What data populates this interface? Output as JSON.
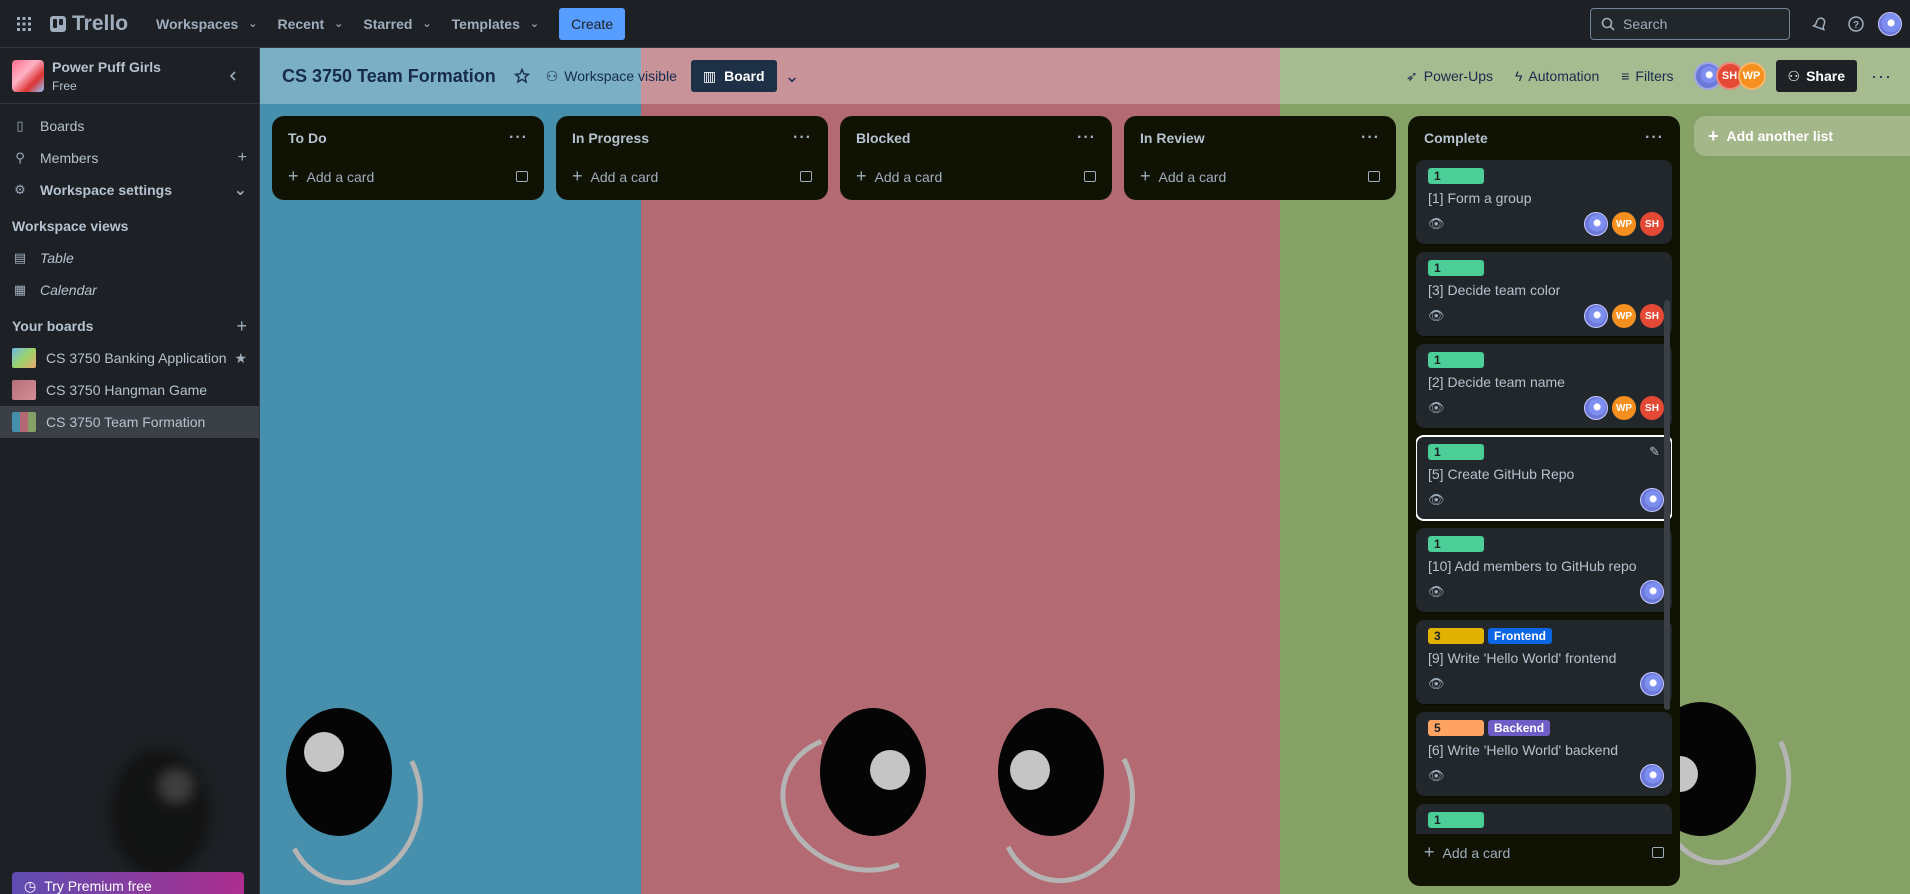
{
  "topnav": {
    "logo": "Trello",
    "menus": [
      "Workspaces",
      "Recent",
      "Starred",
      "Templates"
    ],
    "create": "Create",
    "search_placeholder": "Search"
  },
  "sidebar": {
    "workspace_name": "Power Puff Girls",
    "workspace_plan": "Free",
    "items": [
      {
        "label": "Boards"
      },
      {
        "label": "Members"
      },
      {
        "label": "Workspace settings"
      }
    ],
    "views_heading": "Workspace views",
    "views": [
      {
        "label": "Table"
      },
      {
        "label": "Calendar"
      }
    ],
    "your_boards_heading": "Your boards",
    "boards": [
      {
        "label": "CS 3750 Banking Application"
      },
      {
        "label": "CS 3750 Hangman Game"
      },
      {
        "label": "CS 3750 Team Formation"
      }
    ],
    "premium": "Try Premium free"
  },
  "board_header": {
    "title": "CS 3750 Team Formation",
    "visibility": "Workspace visible",
    "view": "Board",
    "powerups": "Power-Ups",
    "automation": "Automation",
    "filters": "Filters",
    "members": [
      "SH",
      "WP"
    ],
    "share": "Share"
  },
  "lists": [
    {
      "title": "To Do",
      "add": "Add a card"
    },
    {
      "title": "In Progress",
      "add": "Add a card"
    },
    {
      "title": "Blocked",
      "add": "Add a card"
    },
    {
      "title": "In Review",
      "add": "Add a card"
    },
    {
      "title": "Complete",
      "add": "Add a card"
    }
  ],
  "complete_cards": [
    {
      "labels": [
        "1"
      ],
      "title": "[1] Form a group",
      "members": [
        "me",
        "WP",
        "SH"
      ]
    },
    {
      "labels": [
        "1"
      ],
      "title": "[3] Decide team color",
      "members": [
        "me",
        "WP",
        "SH"
      ]
    },
    {
      "labels": [
        "1"
      ],
      "title": "[2] Decide team name",
      "members": [
        "me",
        "WP",
        "SH"
      ]
    },
    {
      "labels": [
        "1"
      ],
      "title": "[5] Create GitHub Repo",
      "members": [
        "me"
      ]
    },
    {
      "labels": [
        "1"
      ],
      "title": "[10] Add members to GitHub repo",
      "members": [
        "me"
      ]
    },
    {
      "labels": [
        "3",
        "Frontend"
      ],
      "title": "[9] Write 'Hello World' frontend",
      "members": [
        "me"
      ]
    },
    {
      "labels": [
        "5",
        "Backend"
      ],
      "title": "[6] Write 'Hello World' backend",
      "members": [
        "me"
      ]
    },
    {
      "labels": [
        "1"
      ],
      "title": "",
      "members": []
    }
  ],
  "add_list": "Add another list",
  "colors": {
    "bg_blue": "#4790ad",
    "bg_red": "#b36a72",
    "bg_green": "#86a166",
    "label_green": "#4bce97",
    "label_yellow": "#e2b203",
    "label_orange": "#fea362",
    "label_blue": "#0c66e4",
    "label_purple": "#6e5dc6"
  }
}
